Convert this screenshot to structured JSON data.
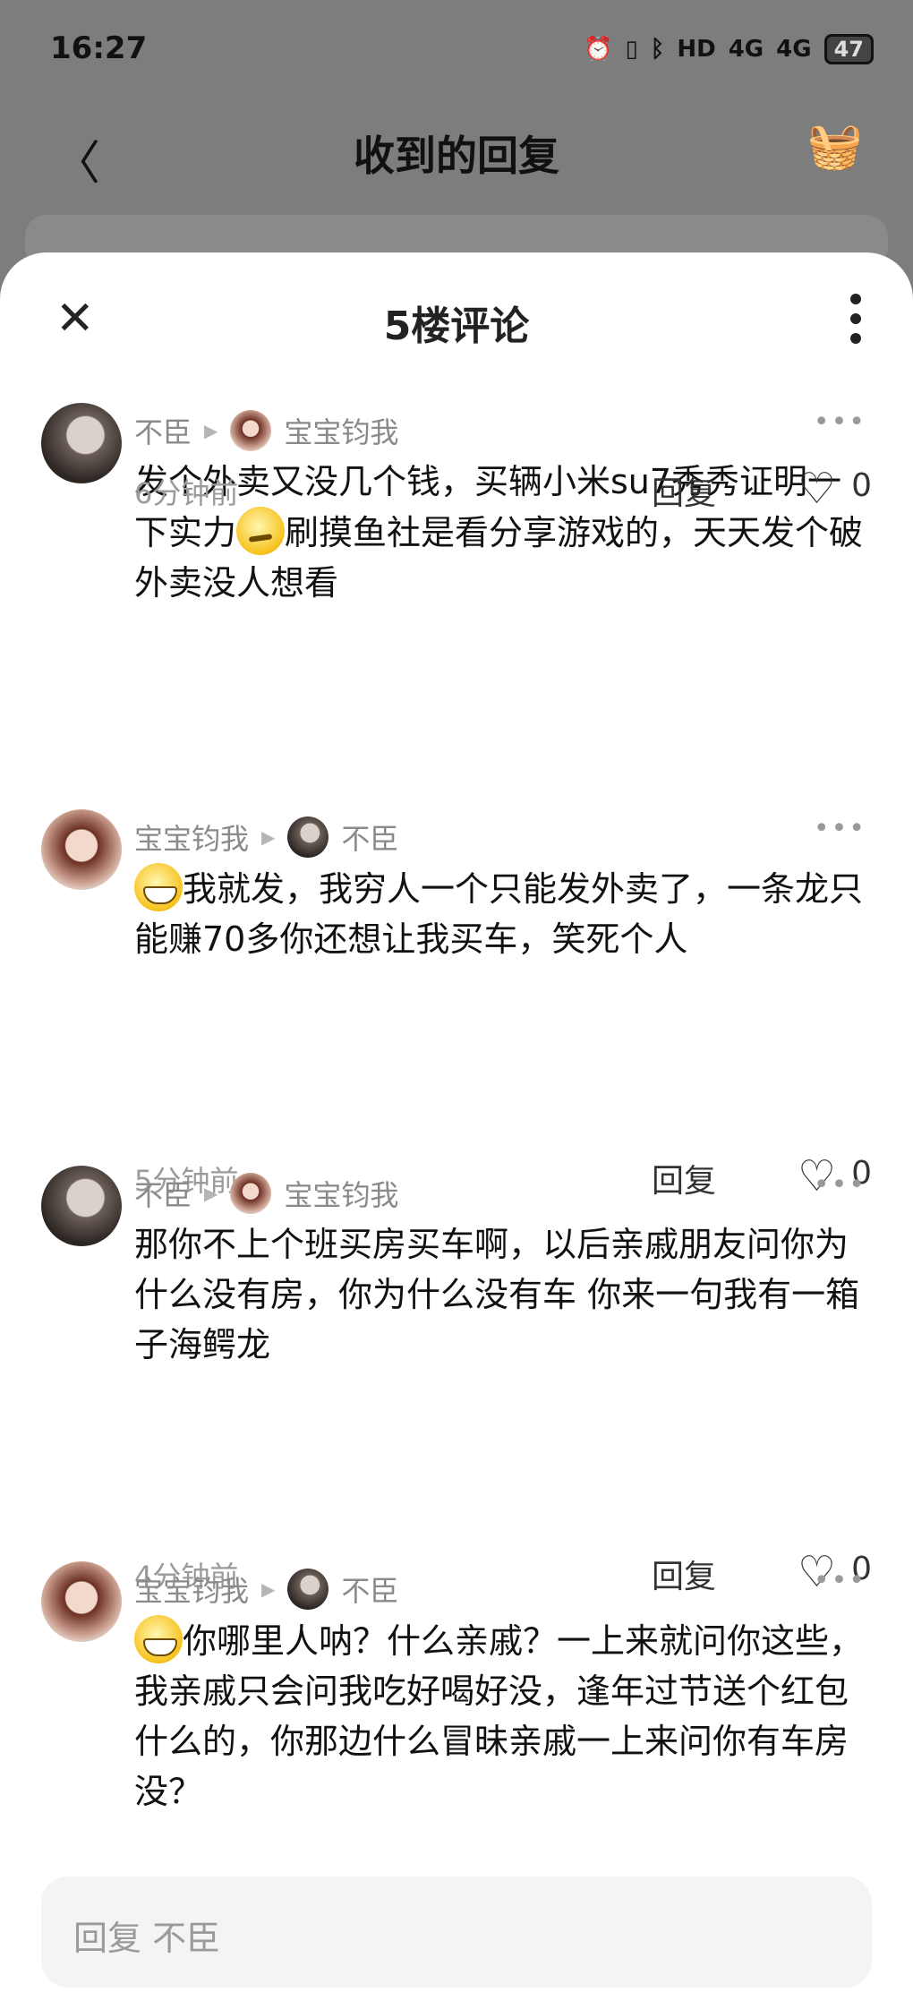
{
  "status_bar": {
    "time": "16:27",
    "indicators": [
      "alarm-icon",
      "vibrate-icon",
      "bluetooth-icon",
      "HD",
      "4G",
      "4G"
    ],
    "battery": "47"
  },
  "header": {
    "title": "收到的回复"
  },
  "sheet": {
    "title": "5楼评论"
  },
  "comments": [
    {
      "author": "不臣",
      "reply_to": "宝宝钧我",
      "parts": [
        "发个外卖又没几个钱，买辆小米su7秀秀证明一下实力",
        "刷摸鱼社是看分享游戏的，天天发个破外卖没人想看"
      ],
      "time": "6分钟前",
      "reply_label": "回复",
      "likes": "0"
    },
    {
      "author": "宝宝钧我",
      "reply_to": "不臣",
      "parts": [
        "",
        "我就发，我穷人一个只能发外卖了，一条龙只能赚70多你还想让我买车，笑死个人"
      ],
      "time": "5分钟前",
      "reply_label": "回复",
      "likes": "0"
    },
    {
      "author": "不臣",
      "reply_to": "宝宝钧我",
      "parts": [
        "那你不上个班买房买车啊，以后亲戚朋友问你为什么没有房，你为什么没有车 你来一句我有一箱子海鳄龙"
      ],
      "time": "4分钟前",
      "reply_label": "回复",
      "likes": "0"
    },
    {
      "author": "宝宝钧我",
      "reply_to": "不臣",
      "parts": [
        "",
        "你哪里人呐？什么亲戚？一上来就问你这些，我亲戚只会问我吃好喝好没，逢年过节送个红包什么的，你那边什么冒昧亲戚一上来问你有车房没？"
      ]
    }
  ],
  "input": {
    "placeholder": "回复 不臣"
  }
}
